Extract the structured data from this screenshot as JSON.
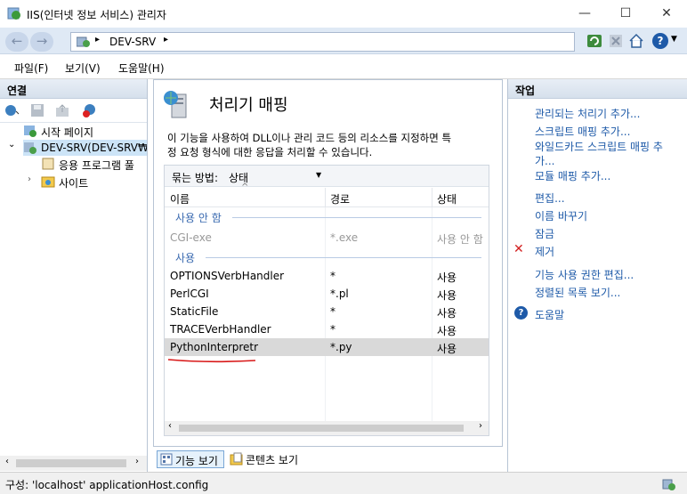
{
  "window": {
    "title": "IIS(인터넷 정보 서비스) 관리자",
    "min": "—",
    "max": "☐",
    "close": "✕"
  },
  "address": {
    "back": "←",
    "forward": "→",
    "path": "DEV-SRV",
    "sep": "▸",
    "help": "?"
  },
  "menu": [
    "파일(F)",
    "보기(V)",
    "도움말(H)"
  ],
  "connections": {
    "header": "연결",
    "tree": [
      "시작 페이지",
      "DEV-SRV(DEV-SRV₩D",
      "응용 프로그램 풀",
      "사이트"
    ]
  },
  "center": {
    "title": "처리기 매핑",
    "desc1": "이 기능을 사용하여 DLL이나 관리 코드 등의 리소스를 지정하면 특",
    "desc2": "정 요청 형식에 대한 응답을 처리할 수 있습니다.",
    "group_label": "묶는 방법:",
    "group_value": "상태",
    "columns": [
      "이름",
      "경로",
      "상태"
    ],
    "group_disabled": "사용 안 함",
    "group_enabled": "사용",
    "rows": [
      {
        "name": "CGI-exe",
        "path": "*.exe",
        "state": "사용 안 함"
      },
      {
        "name": "OPTIONSVerbHandler",
        "path": "*",
        "state": "사용"
      },
      {
        "name": "PerlCGI",
        "path": "*.pl",
        "state": "사용"
      },
      {
        "name": "StaticFile",
        "path": "*",
        "state": "사용"
      },
      {
        "name": "TRACEVerbHandler",
        "path": "*",
        "state": "사용"
      },
      {
        "name": "PythonInterpretr",
        "path": "*.py",
        "state": "사용"
      }
    ],
    "view_features": "기능 보기",
    "view_content": "콘텐츠 보기"
  },
  "actions": {
    "header": "작업",
    "items": [
      "관리되는 처리기 추가...",
      "스크립트 매핑 추가...",
      "와일드카드 스크립트 매핑 추",
      "가...",
      "모듈 매핑 추가...",
      "편집...",
      "이름 바꾸기",
      "잠금",
      "제거",
      "기능 사용 권한 편집...",
      "정렬된 목록 보기...",
      "도움말"
    ]
  },
  "status": "구성: 'localhost' applicationHost.config"
}
